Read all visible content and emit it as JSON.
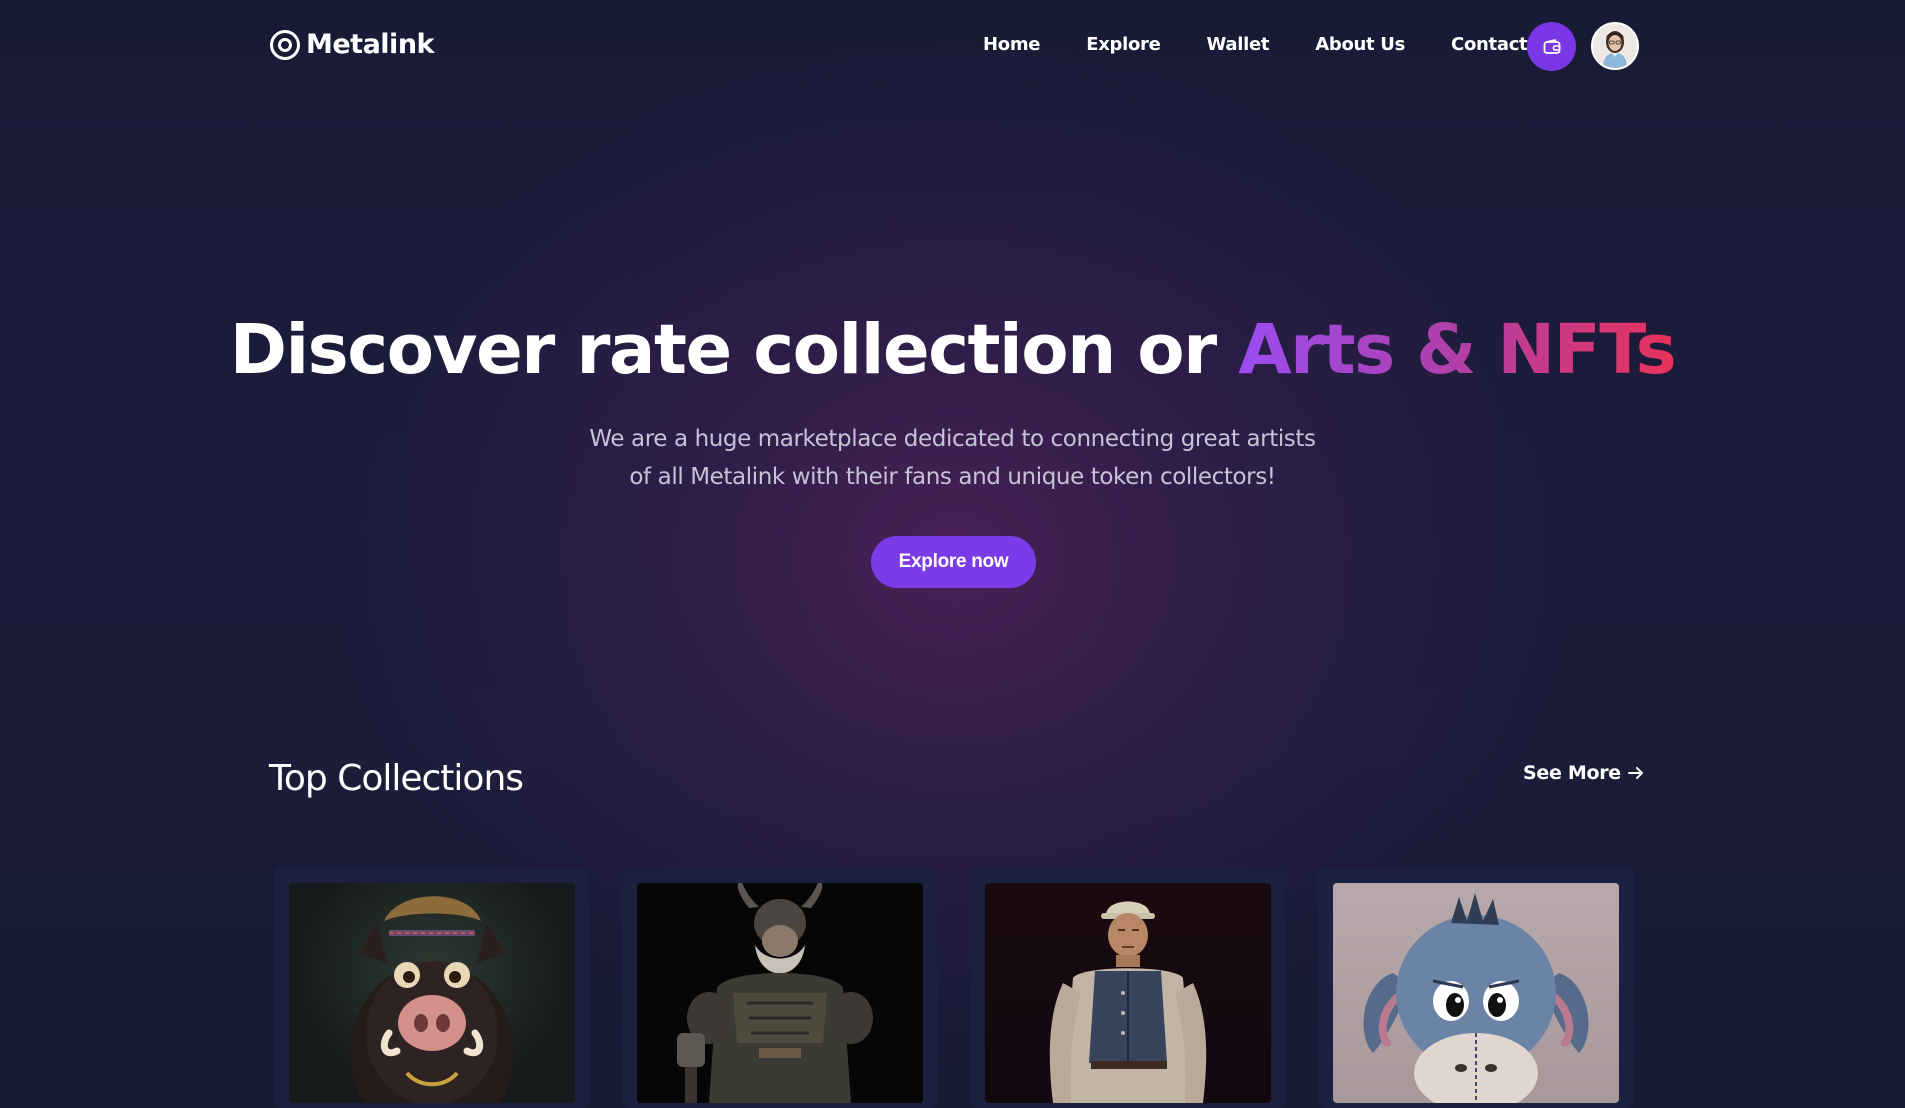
{
  "nav": {
    "logo": "Metalink",
    "links": [
      "Home",
      "Explore",
      "Wallet",
      "About Us",
      "Contact"
    ],
    "wallet_icon": "wallet-icon",
    "avatar": "user-avatar"
  },
  "hero": {
    "title_plain": "Discover rate collection or ",
    "title_highlight": "Arts & NFTs",
    "subtitle_line1": "We are a huge marketplace dedicated to connecting great artists",
    "subtitle_line2": "of all Metalink with their fans and unique token collectors!",
    "cta": "Explore now"
  },
  "collections": {
    "title": "Top Collections",
    "see_more": "See More",
    "cards": [
      {
        "subject": "boar-nft"
      },
      {
        "subject": "viking-nft"
      },
      {
        "subject": "worker-nft"
      },
      {
        "subject": "donkey-nft"
      }
    ]
  },
  "colors": {
    "accent": "#7b36e6",
    "background": "#171b33",
    "gradient_start": "#9b4cf0",
    "gradient_end": "#e8325a"
  }
}
